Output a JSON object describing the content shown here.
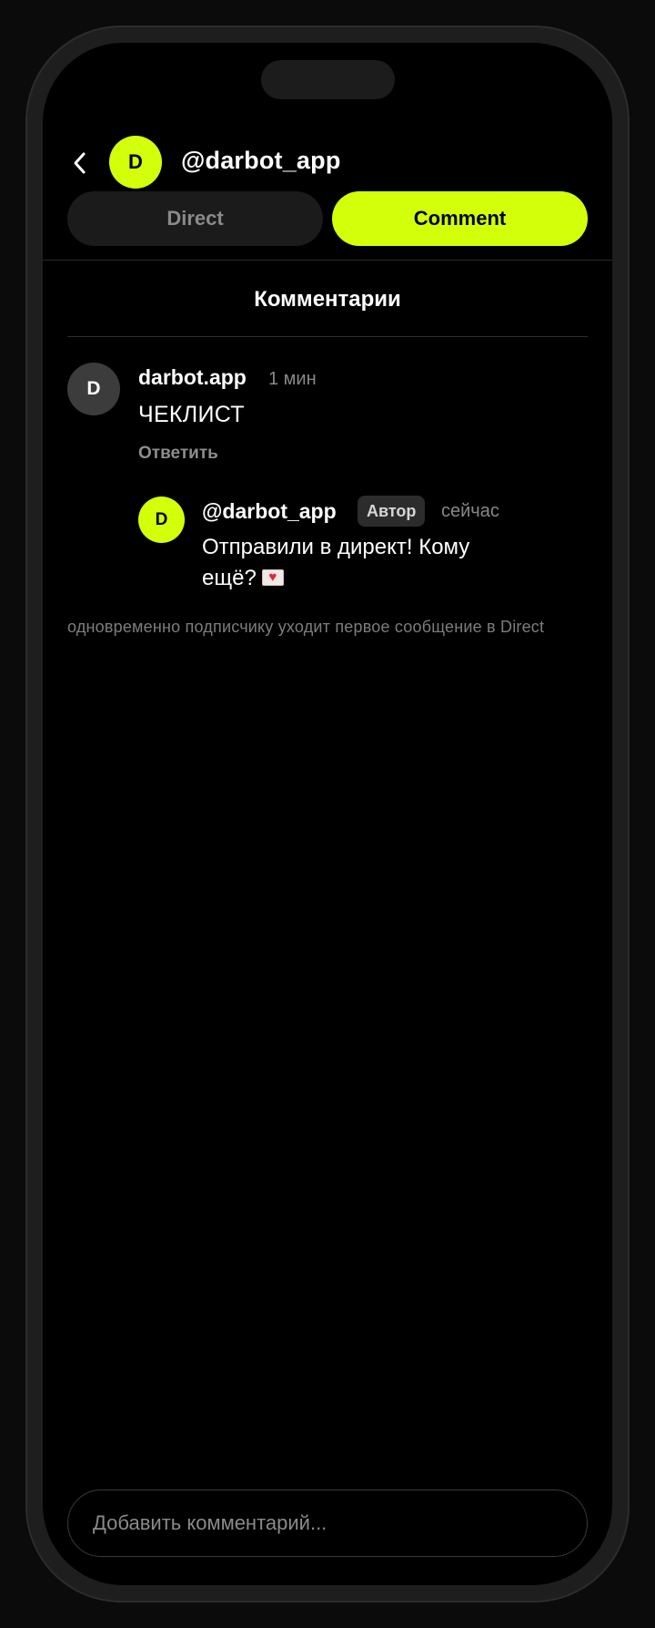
{
  "header": {
    "avatar_letter": "D",
    "handle": "@darbot_app"
  },
  "tabs": [
    {
      "label": "Direct",
      "active": false
    },
    {
      "label": "Comment",
      "active": true
    }
  ],
  "section_title": "Комментарии",
  "comment": {
    "avatar_letter": "D",
    "author": "darbot.app",
    "time": "1 мин",
    "text": "ЧЕКЛИСТ",
    "reply_label": "Ответить"
  },
  "reply": {
    "avatar_letter": "D",
    "author": "@darbot_app",
    "badge": "Автор",
    "time": "сейчас",
    "text": "Отправили в директ! Кому ещё?",
    "emoji_icon": "love-letter-icon"
  },
  "note": "одновременно подписчику уходит первое сообщение в Direct",
  "input": {
    "placeholder": "Добавить комментарий..."
  },
  "colors": {
    "accent": "#d3ff0a",
    "background": "#000000",
    "muted_text": "#888888"
  }
}
